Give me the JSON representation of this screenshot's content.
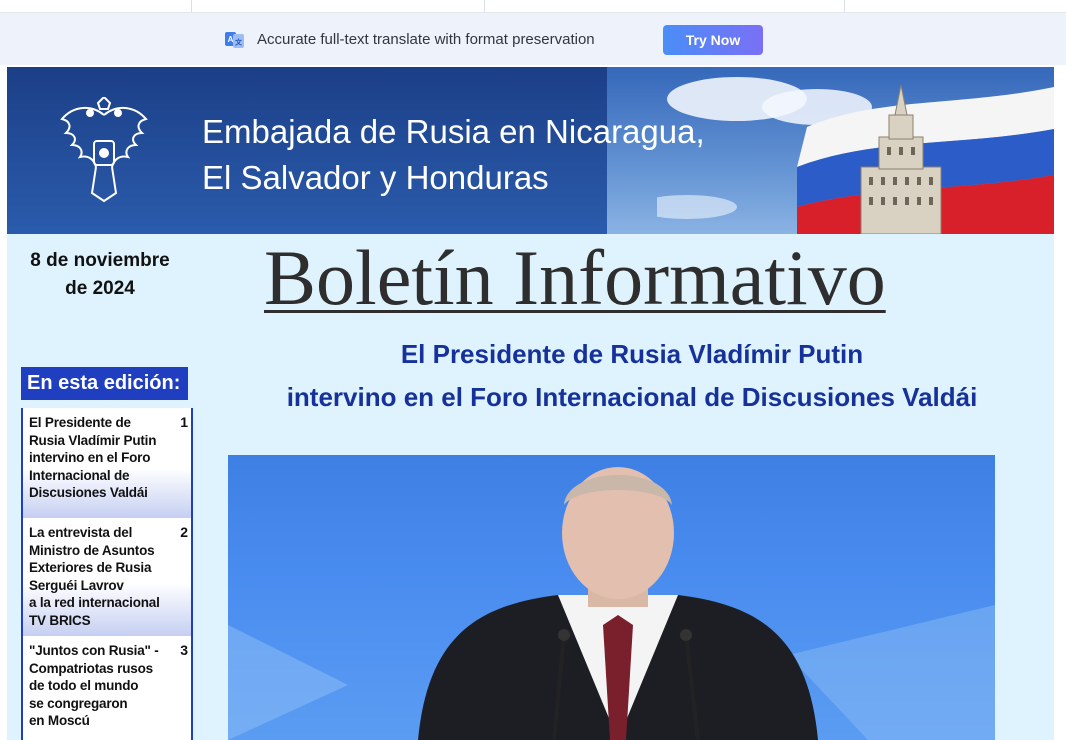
{
  "translate_bar": {
    "icon": "translate-icon",
    "message": "Accurate full-text translate with format preservation",
    "button_label": "Try Now"
  },
  "banner": {
    "title_line1": "Embajada de Rusia en Nicaragua,",
    "title_line2": "El Salvador y Honduras",
    "emblem": "russian-coat-of-arms",
    "image": "russian-flag-and-ministry-building"
  },
  "date": {
    "line1": "8 de noviembre",
    "line2": "de 2024"
  },
  "newsletter_title": "Boletín Informativo",
  "headline": {
    "line1": "El Presidente de Rusia Vladímir Putin",
    "line2": "intervino en el Foro Internacional de Discusiones Valdái"
  },
  "toc": {
    "heading": "En esta edición:",
    "items": [
      {
        "lines": [
          "El Presidente de",
          "Rusia Vladímir Putin",
          "intervino en el Foro",
          "Internacional de",
          "Discusiones Valdái"
        ],
        "page": "1"
      },
      {
        "lines": [
          "La entrevista del",
          "Ministro de Asuntos",
          "Exteriores de Rusia",
          "Serguéi Lavrov",
          "a la  red internacional",
          "TV BRICS"
        ],
        "page": "2"
      },
      {
        "lines": [
          "\"Juntos con Rusia\" -",
          "Compatriotas rusos",
          "de todo el mundo",
          "se congregaron",
          "en Moscú"
        ],
        "page": "3"
      }
    ]
  },
  "photo": "president-speaking-at-podium",
  "colors": {
    "accent_blue": "#1f3fc0",
    "headline_blue": "#16329a",
    "page_bg": "#dff3fe",
    "button_gradient_start": "#4a8ef6",
    "button_gradient_end": "#7a6ff6"
  }
}
